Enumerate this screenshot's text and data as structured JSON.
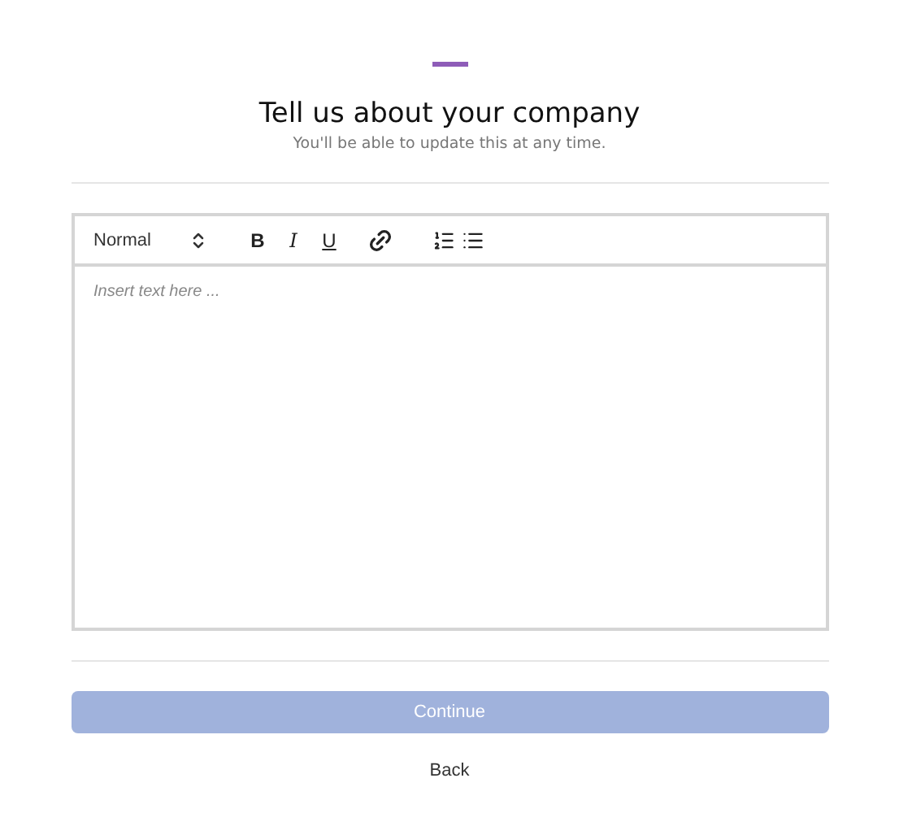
{
  "header": {
    "title": "Tell us about your company",
    "subtitle": "You'll be able to update this at any time."
  },
  "editor": {
    "format": "Normal",
    "buttons": [
      {
        "kind": "bold",
        "label": "B"
      },
      {
        "kind": "italic",
        "label": "I"
      },
      {
        "kind": "underline",
        "label": "U"
      },
      {
        "kind": "link"
      },
      {
        "kind": "ordered-list"
      },
      {
        "kind": "bullet-list"
      }
    ],
    "placeholder": "Insert text here ..."
  },
  "continue_button": {
    "label": "Continue",
    "disabled": true
  },
  "back_link": {
    "label": "Back"
  }
}
